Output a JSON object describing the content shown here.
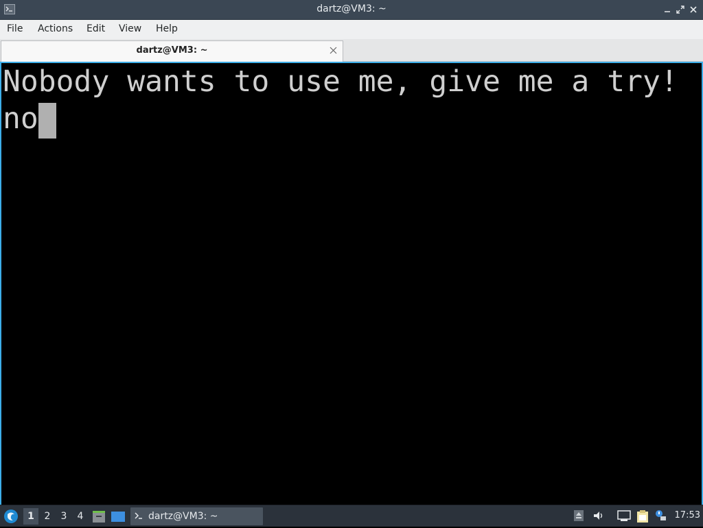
{
  "window": {
    "title": "dartz@VM3: ~",
    "minimize_icon": "minimize-icon",
    "restore_icon": "restore-icon",
    "close_icon": "close-icon"
  },
  "menubar": {
    "items": [
      "File",
      "Actions",
      "Edit",
      "View",
      "Help"
    ]
  },
  "tabs": [
    {
      "label": "dartz@VM3: ~",
      "close_icon": "close-icon",
      "active": true
    }
  ],
  "terminal": {
    "lines": [
      "Nobody wants to use me, give me a try!",
      "no"
    ],
    "foreground": "#cfcfcf",
    "background": "#000000",
    "cursor_color": "#b0b0b0",
    "border_accent": "#3daee9"
  },
  "taskbar": {
    "workspaces": [
      "1",
      "2",
      "3",
      "4"
    ],
    "active_workspace": "1",
    "launchers": [
      "file-manager-icon",
      "desktop-icon"
    ],
    "tasks": [
      {
        "label": "dartz@VM3: ~",
        "icon": "terminal-icon"
      }
    ],
    "tray_icons": [
      "eject-icon",
      "volume-icon",
      "network-icon",
      "clipboard-icon",
      "update-notifier-icon"
    ],
    "clock": "17:53"
  }
}
